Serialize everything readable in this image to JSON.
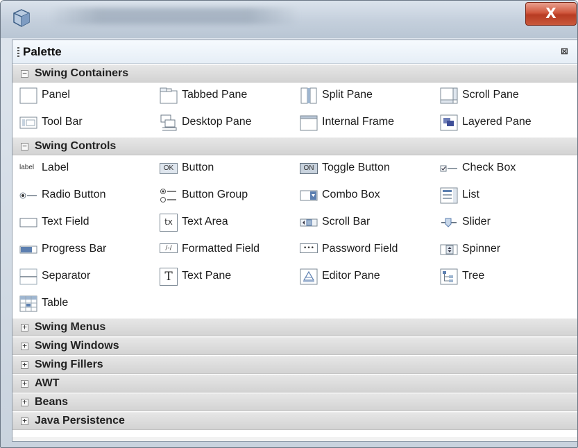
{
  "window": {
    "close_label": "X"
  },
  "palette": {
    "title": "Palette",
    "close_glyph": "⊠"
  },
  "sections": [
    {
      "label": "Swing Containers",
      "expanded": true,
      "toggle": "−"
    },
    {
      "label": "Swing Controls",
      "expanded": true,
      "toggle": "−"
    },
    {
      "label": "Swing Menus",
      "expanded": false,
      "toggle": "+"
    },
    {
      "label": "Swing Windows",
      "expanded": false,
      "toggle": "+"
    },
    {
      "label": "Swing Fillers",
      "expanded": false,
      "toggle": "+"
    },
    {
      "label": "AWT",
      "expanded": false,
      "toggle": "+"
    },
    {
      "label": "Beans",
      "expanded": false,
      "toggle": "+"
    },
    {
      "label": "Java Persistence",
      "expanded": false,
      "toggle": "+"
    }
  ],
  "containers": [
    {
      "label": "Panel",
      "icon": "panel-icon"
    },
    {
      "label": "Tabbed Pane",
      "icon": "tabbed-pane-icon"
    },
    {
      "label": "Split Pane",
      "icon": "split-pane-icon"
    },
    {
      "label": "Scroll Pane",
      "icon": "scroll-pane-icon"
    },
    {
      "label": "Tool Bar",
      "icon": "tool-bar-icon"
    },
    {
      "label": "Desktop Pane",
      "icon": "desktop-pane-icon"
    },
    {
      "label": "Internal Frame",
      "icon": "internal-frame-icon"
    },
    {
      "label": "Layered Pane",
      "icon": "layered-pane-icon"
    }
  ],
  "controls": [
    {
      "label": "Label",
      "icon": "label-icon",
      "icon_text": "label"
    },
    {
      "label": "Button",
      "icon": "button-icon",
      "icon_text": "OK"
    },
    {
      "label": "Toggle Button",
      "icon": "toggle-button-icon",
      "icon_text": "ON"
    },
    {
      "label": "Check Box",
      "icon": "check-box-icon"
    },
    {
      "label": "Radio Button",
      "icon": "radio-button-icon"
    },
    {
      "label": "Button Group",
      "icon": "button-group-icon"
    },
    {
      "label": "Combo Box",
      "icon": "combo-box-icon"
    },
    {
      "label": "List",
      "icon": "list-icon"
    },
    {
      "label": "Text Field",
      "icon": "text-field-icon"
    },
    {
      "label": "Text Area",
      "icon": "text-area-icon",
      "icon_text": "tx"
    },
    {
      "label": "Scroll Bar",
      "icon": "scroll-bar-icon"
    },
    {
      "label": "Slider",
      "icon": "slider-icon"
    },
    {
      "label": "Progress Bar",
      "icon": "progress-bar-icon"
    },
    {
      "label": "Formatted Field",
      "icon": "formatted-field-icon",
      "icon_text": "/-/"
    },
    {
      "label": "Password Field",
      "icon": "password-field-icon",
      "icon_text": "•••"
    },
    {
      "label": "Spinner",
      "icon": "spinner-icon"
    },
    {
      "label": "Separator",
      "icon": "separator-icon"
    },
    {
      "label": "Text Pane",
      "icon": "text-pane-icon",
      "icon_text": "T"
    },
    {
      "label": "Editor Pane",
      "icon": "editor-pane-icon"
    },
    {
      "label": "Tree",
      "icon": "tree-icon"
    },
    {
      "label": "Table",
      "icon": "table-icon"
    }
  ]
}
